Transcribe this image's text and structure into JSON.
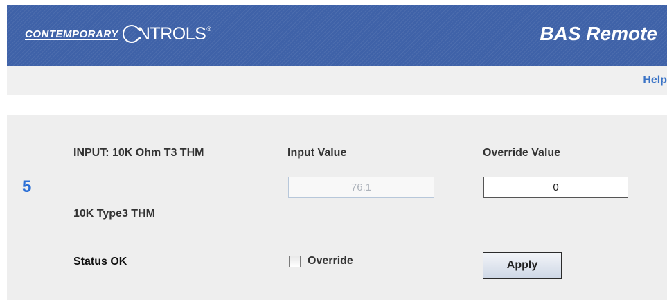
{
  "header": {
    "logo_part1": "CONTEMPORARY",
    "logo_part2": "NTROLS",
    "logo_reg": "®",
    "title": "BAS Remote",
    "brand_color": "#3f62a8"
  },
  "help": {
    "label": "Help"
  },
  "point": {
    "number": "5",
    "input_type": "INPUT: 10K Ohm T3 THM",
    "sensor_label": "10K Type3 THM",
    "status": "Status OK",
    "input_value_label": "Input Value",
    "input_value": "76.1",
    "override_value_label": "Override Value",
    "override_value": "0",
    "override_checkbox_label": "Override",
    "override_checked": false,
    "apply_label": "Apply"
  }
}
